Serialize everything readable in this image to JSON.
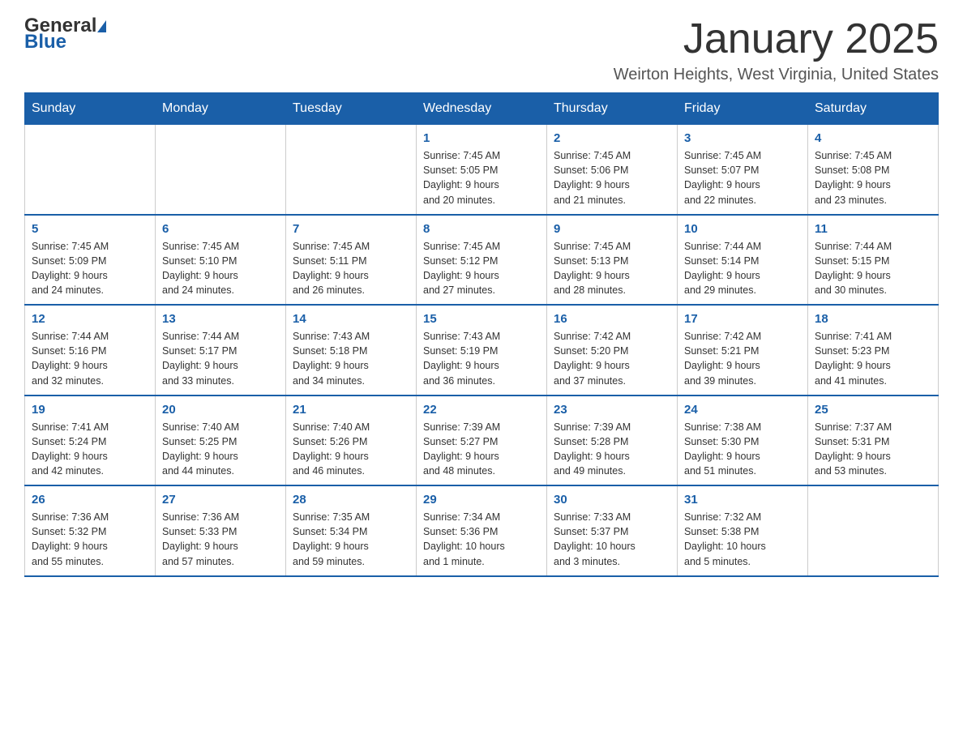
{
  "logo": {
    "general": "General",
    "arrow": "▶",
    "blue": "Blue"
  },
  "title": {
    "month_year": "January 2025",
    "location": "Weirton Heights, West Virginia, United States"
  },
  "weekdays": [
    "Sunday",
    "Monday",
    "Tuesday",
    "Wednesday",
    "Thursday",
    "Friday",
    "Saturday"
  ],
  "weeks": [
    [
      {
        "day": "",
        "info": ""
      },
      {
        "day": "",
        "info": ""
      },
      {
        "day": "",
        "info": ""
      },
      {
        "day": "1",
        "info": "Sunrise: 7:45 AM\nSunset: 5:05 PM\nDaylight: 9 hours\nand 20 minutes."
      },
      {
        "day": "2",
        "info": "Sunrise: 7:45 AM\nSunset: 5:06 PM\nDaylight: 9 hours\nand 21 minutes."
      },
      {
        "day": "3",
        "info": "Sunrise: 7:45 AM\nSunset: 5:07 PM\nDaylight: 9 hours\nand 22 minutes."
      },
      {
        "day": "4",
        "info": "Sunrise: 7:45 AM\nSunset: 5:08 PM\nDaylight: 9 hours\nand 23 minutes."
      }
    ],
    [
      {
        "day": "5",
        "info": "Sunrise: 7:45 AM\nSunset: 5:09 PM\nDaylight: 9 hours\nand 24 minutes."
      },
      {
        "day": "6",
        "info": "Sunrise: 7:45 AM\nSunset: 5:10 PM\nDaylight: 9 hours\nand 24 minutes."
      },
      {
        "day": "7",
        "info": "Sunrise: 7:45 AM\nSunset: 5:11 PM\nDaylight: 9 hours\nand 26 minutes."
      },
      {
        "day": "8",
        "info": "Sunrise: 7:45 AM\nSunset: 5:12 PM\nDaylight: 9 hours\nand 27 minutes."
      },
      {
        "day": "9",
        "info": "Sunrise: 7:45 AM\nSunset: 5:13 PM\nDaylight: 9 hours\nand 28 minutes."
      },
      {
        "day": "10",
        "info": "Sunrise: 7:44 AM\nSunset: 5:14 PM\nDaylight: 9 hours\nand 29 minutes."
      },
      {
        "day": "11",
        "info": "Sunrise: 7:44 AM\nSunset: 5:15 PM\nDaylight: 9 hours\nand 30 minutes."
      }
    ],
    [
      {
        "day": "12",
        "info": "Sunrise: 7:44 AM\nSunset: 5:16 PM\nDaylight: 9 hours\nand 32 minutes."
      },
      {
        "day": "13",
        "info": "Sunrise: 7:44 AM\nSunset: 5:17 PM\nDaylight: 9 hours\nand 33 minutes."
      },
      {
        "day": "14",
        "info": "Sunrise: 7:43 AM\nSunset: 5:18 PM\nDaylight: 9 hours\nand 34 minutes."
      },
      {
        "day": "15",
        "info": "Sunrise: 7:43 AM\nSunset: 5:19 PM\nDaylight: 9 hours\nand 36 minutes."
      },
      {
        "day": "16",
        "info": "Sunrise: 7:42 AM\nSunset: 5:20 PM\nDaylight: 9 hours\nand 37 minutes."
      },
      {
        "day": "17",
        "info": "Sunrise: 7:42 AM\nSunset: 5:21 PM\nDaylight: 9 hours\nand 39 minutes."
      },
      {
        "day": "18",
        "info": "Sunrise: 7:41 AM\nSunset: 5:23 PM\nDaylight: 9 hours\nand 41 minutes."
      }
    ],
    [
      {
        "day": "19",
        "info": "Sunrise: 7:41 AM\nSunset: 5:24 PM\nDaylight: 9 hours\nand 42 minutes."
      },
      {
        "day": "20",
        "info": "Sunrise: 7:40 AM\nSunset: 5:25 PM\nDaylight: 9 hours\nand 44 minutes."
      },
      {
        "day": "21",
        "info": "Sunrise: 7:40 AM\nSunset: 5:26 PM\nDaylight: 9 hours\nand 46 minutes."
      },
      {
        "day": "22",
        "info": "Sunrise: 7:39 AM\nSunset: 5:27 PM\nDaylight: 9 hours\nand 48 minutes."
      },
      {
        "day": "23",
        "info": "Sunrise: 7:39 AM\nSunset: 5:28 PM\nDaylight: 9 hours\nand 49 minutes."
      },
      {
        "day": "24",
        "info": "Sunrise: 7:38 AM\nSunset: 5:30 PM\nDaylight: 9 hours\nand 51 minutes."
      },
      {
        "day": "25",
        "info": "Sunrise: 7:37 AM\nSunset: 5:31 PM\nDaylight: 9 hours\nand 53 minutes."
      }
    ],
    [
      {
        "day": "26",
        "info": "Sunrise: 7:36 AM\nSunset: 5:32 PM\nDaylight: 9 hours\nand 55 minutes."
      },
      {
        "day": "27",
        "info": "Sunrise: 7:36 AM\nSunset: 5:33 PM\nDaylight: 9 hours\nand 57 minutes."
      },
      {
        "day": "28",
        "info": "Sunrise: 7:35 AM\nSunset: 5:34 PM\nDaylight: 9 hours\nand 59 minutes."
      },
      {
        "day": "29",
        "info": "Sunrise: 7:34 AM\nSunset: 5:36 PM\nDaylight: 10 hours\nand 1 minute."
      },
      {
        "day": "30",
        "info": "Sunrise: 7:33 AM\nSunset: 5:37 PM\nDaylight: 10 hours\nand 3 minutes."
      },
      {
        "day": "31",
        "info": "Sunrise: 7:32 AM\nSunset: 5:38 PM\nDaylight: 10 hours\nand 5 minutes."
      },
      {
        "day": "",
        "info": ""
      }
    ]
  ]
}
